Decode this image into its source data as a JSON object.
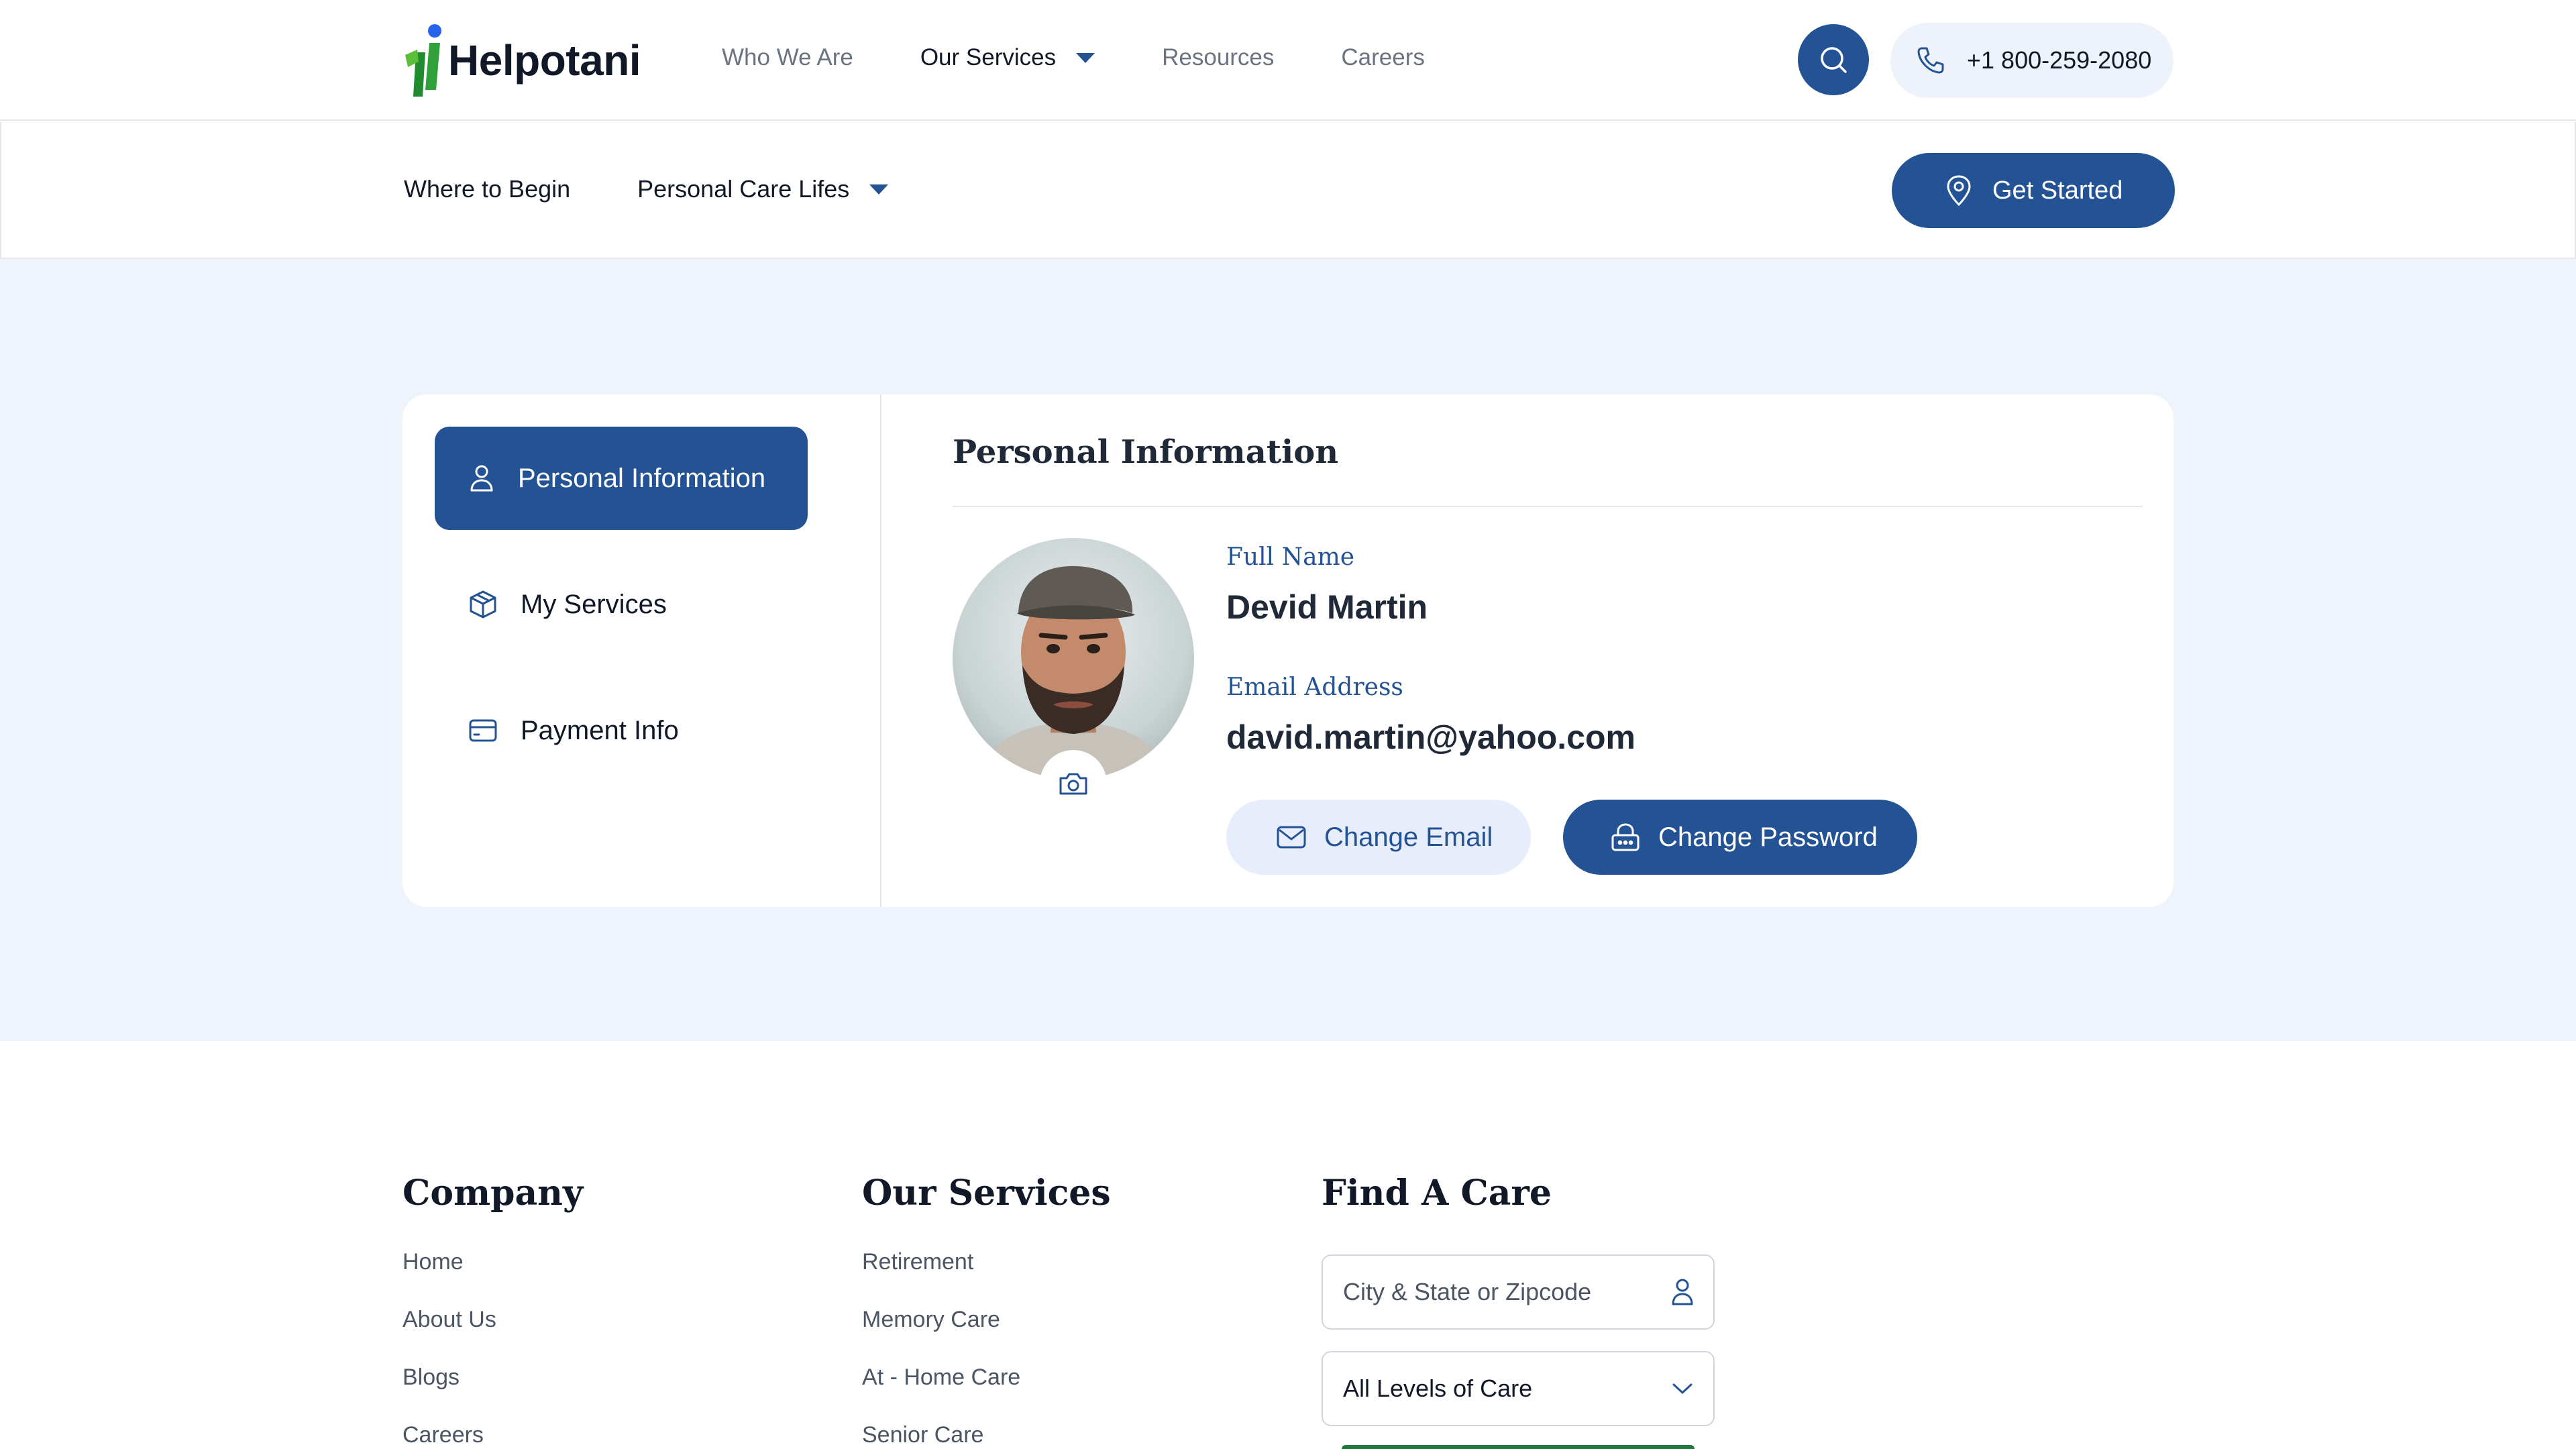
{
  "brand": {
    "name": "Helpotani",
    "primary": "#245395",
    "accent_green": "#2fa03a"
  },
  "nav": {
    "links": [
      {
        "label": "Who We Are"
      },
      {
        "label": "Our Services"
      },
      {
        "label": "Resources"
      },
      {
        "label": "Careers"
      }
    ],
    "phone": "+1 800-259-2080"
  },
  "subnav": {
    "links": [
      {
        "label": "Where to Begin"
      },
      {
        "label": "Personal Care Lifes"
      }
    ],
    "cta": "Get Started"
  },
  "sidebar": {
    "items": [
      {
        "label": "Personal Information",
        "icon": "user-icon"
      },
      {
        "label": "My Services",
        "icon": "box-icon"
      },
      {
        "label": "Payment Info",
        "icon": "credit-card-icon"
      }
    ]
  },
  "profile": {
    "title": "Personal Information",
    "full_name_label": "Full Name",
    "full_name": "Devid Martin",
    "email_label": "Email Address",
    "email": "david.martin@yahoo.com",
    "change_email": "Change Email",
    "change_password": "Change Password"
  },
  "footer": {
    "company": {
      "title": "Company",
      "links": [
        "Home",
        "About Us",
        "Blogs",
        "Careers"
      ]
    },
    "services": {
      "title": "Our Services",
      "links": [
        "Retirement",
        "Memory Care",
        "At - Home Care",
        "Senior Care"
      ]
    },
    "find": {
      "title": "Find A Care",
      "location_placeholder": "City & State or Zipcode",
      "level_value": "All Levels of Care"
    }
  }
}
